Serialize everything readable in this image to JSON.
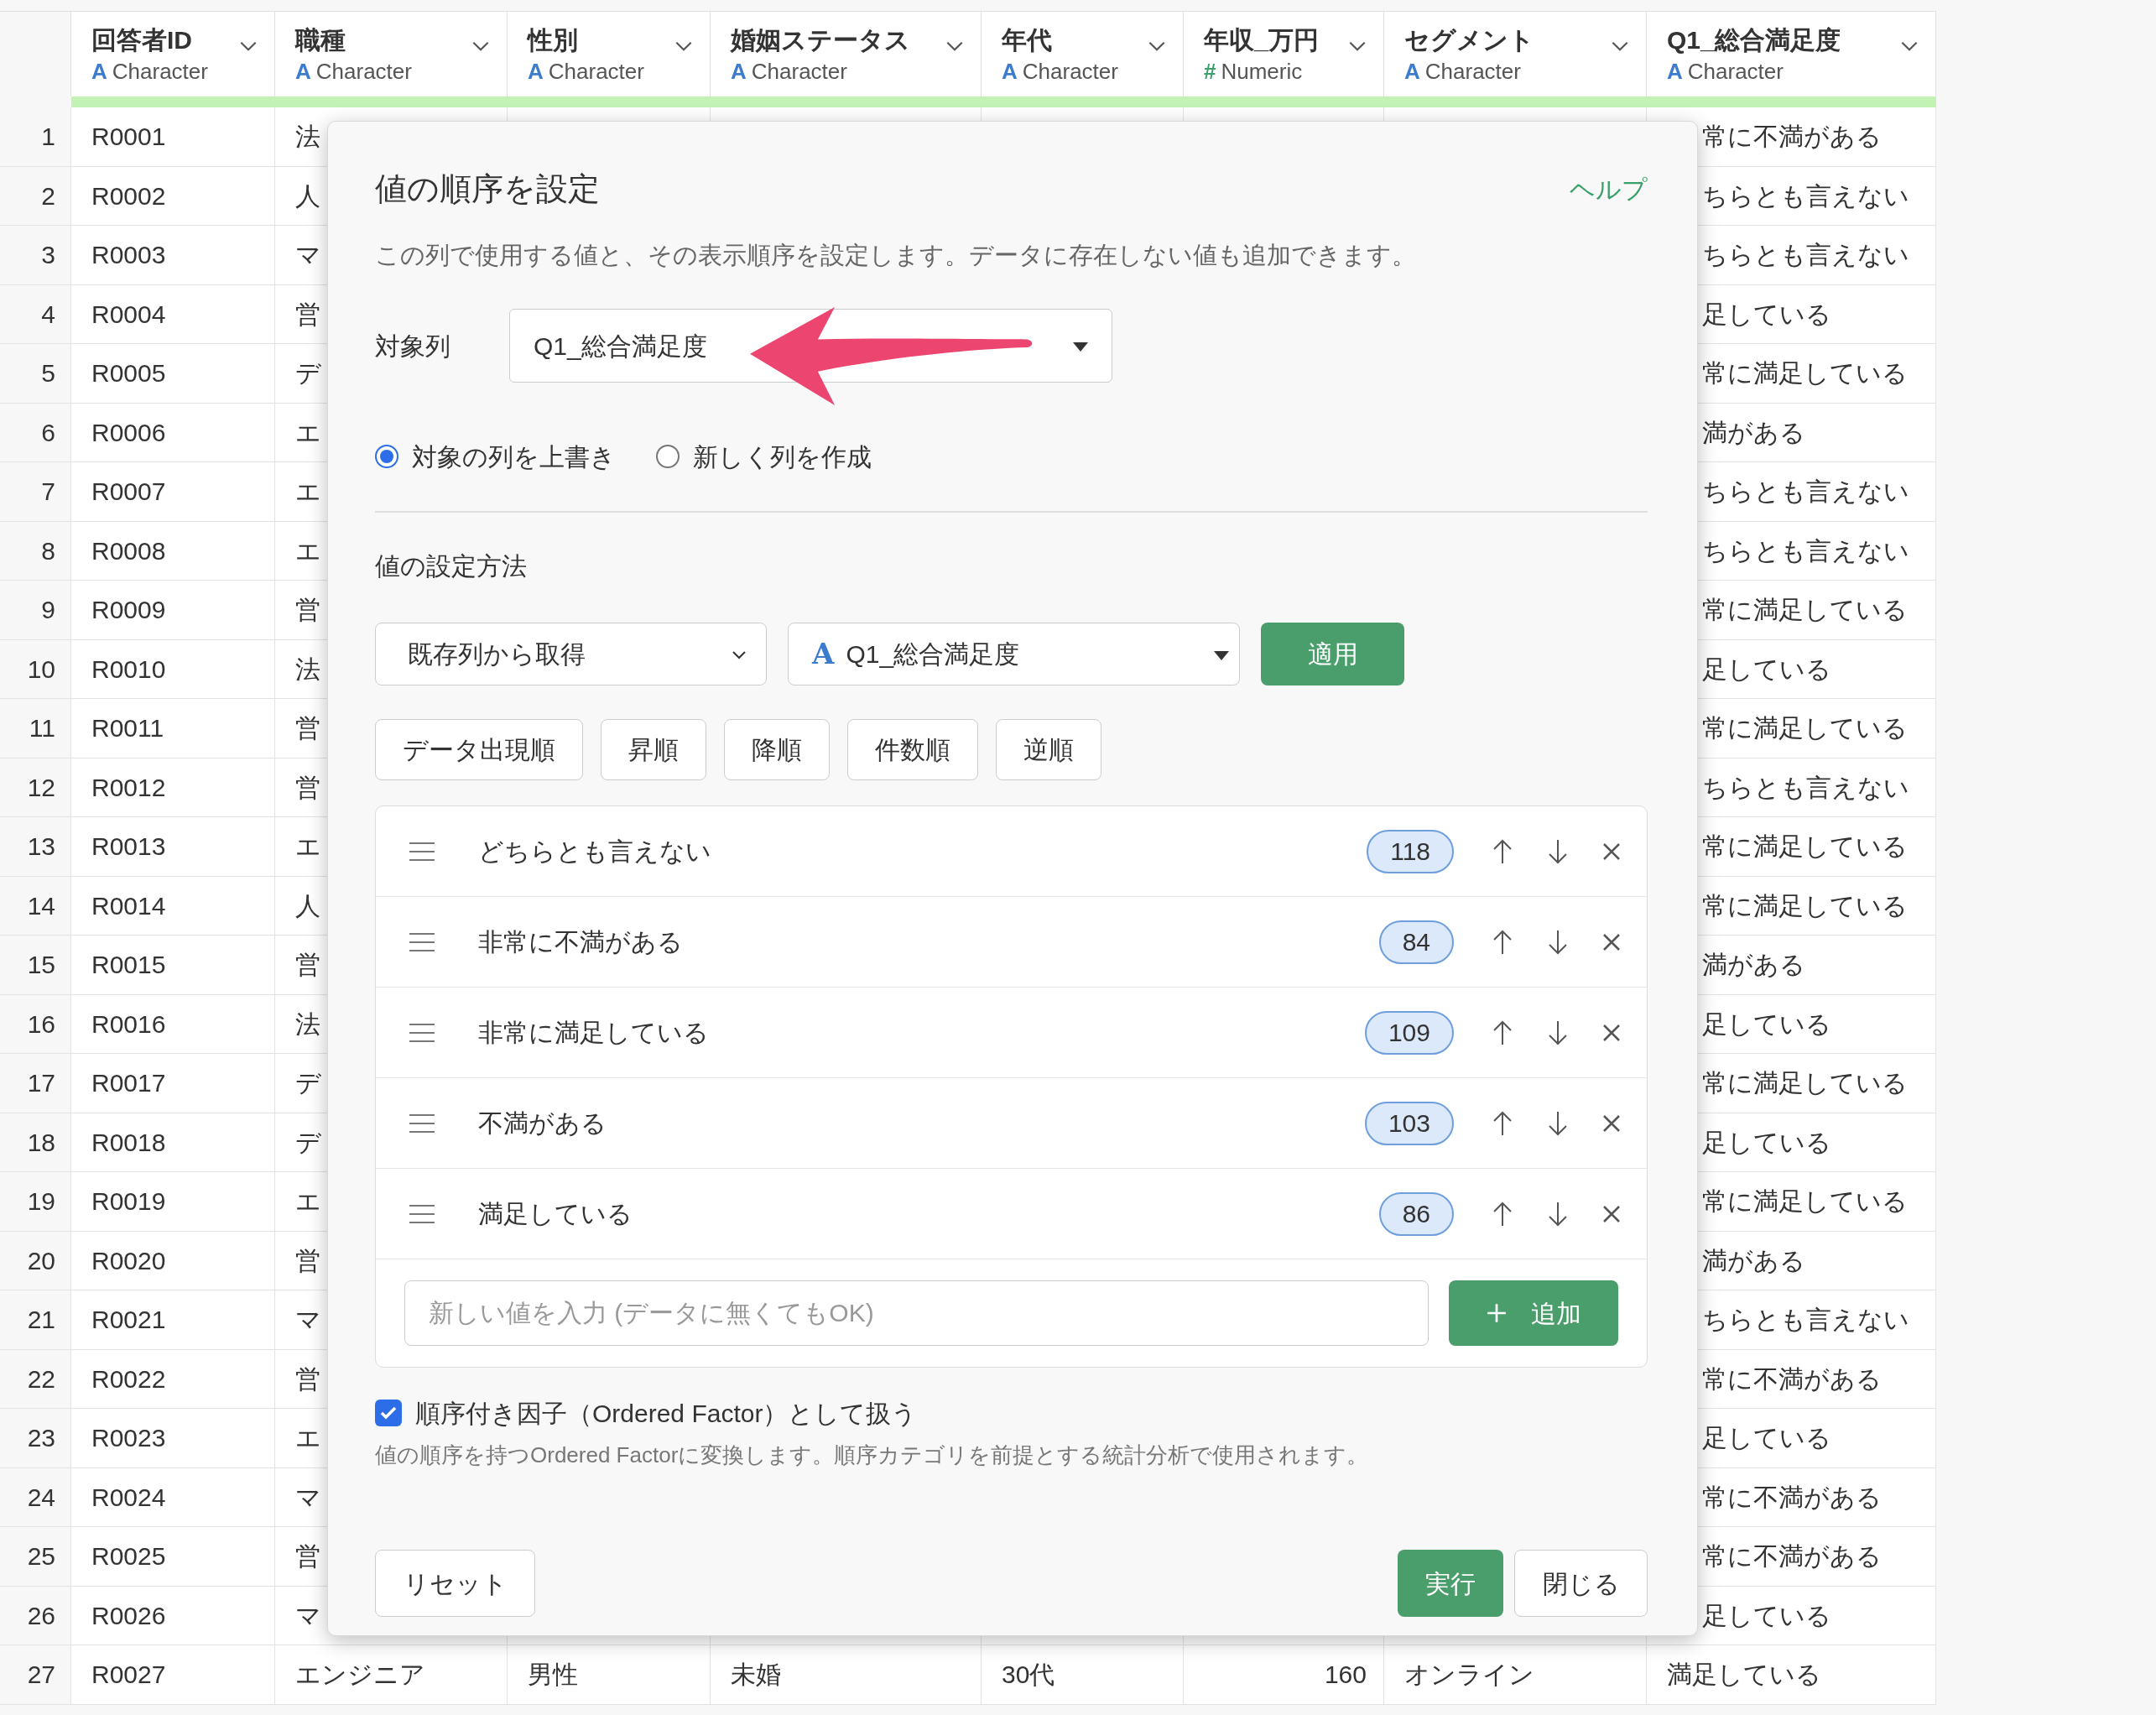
{
  "table": {
    "columns": [
      {
        "name": "回答者ID",
        "kind": "character",
        "icon": "A",
        "type": "Character"
      },
      {
        "name": "職種",
        "kind": "character",
        "icon": "A",
        "type": "Character"
      },
      {
        "name": "性別",
        "kind": "character",
        "icon": "A",
        "type": "Character"
      },
      {
        "name": "婚姻ステータス",
        "kind": "character",
        "icon": "A",
        "type": "Character"
      },
      {
        "name": "年代",
        "kind": "character",
        "icon": "A",
        "type": "Character"
      },
      {
        "name": "年収_万円",
        "kind": "numeric",
        "icon": "#",
        "type": "Numeric"
      },
      {
        "name": "セグメント",
        "kind": "character",
        "icon": "A",
        "type": "Character"
      },
      {
        "name": "Q1_総合満足度",
        "kind": "character",
        "icon": "A",
        "type": "Character"
      }
    ],
    "rows": [
      {
        "number": "1",
        "kind": "covered",
        "cells": [
          "R0001",
          "法",
          "常に不満がある"
        ]
      },
      {
        "number": "2",
        "kind": "covered",
        "cells": [
          "R0002",
          "人",
          "ちらとも言えない"
        ]
      },
      {
        "number": "3",
        "kind": "covered",
        "cells": [
          "R0003",
          "マ",
          "ちらとも言えない"
        ]
      },
      {
        "number": "4",
        "kind": "covered",
        "cells": [
          "R0004",
          "営",
          "足している"
        ]
      },
      {
        "number": "5",
        "kind": "covered",
        "cells": [
          "R0005",
          "デ",
          "常に満足している"
        ]
      },
      {
        "number": "6",
        "kind": "covered",
        "cells": [
          "R0006",
          "エ",
          "満がある"
        ]
      },
      {
        "number": "7",
        "kind": "covered",
        "cells": [
          "R0007",
          "エ",
          "ちらとも言えない"
        ]
      },
      {
        "number": "8",
        "kind": "covered",
        "cells": [
          "R0008",
          "エ",
          "ちらとも言えない"
        ]
      },
      {
        "number": "9",
        "kind": "covered",
        "cells": [
          "R0009",
          "営",
          "常に満足している"
        ]
      },
      {
        "number": "10",
        "kind": "covered",
        "cells": [
          "R0010",
          "法",
          "足している"
        ]
      },
      {
        "number": "11",
        "kind": "covered",
        "cells": [
          "R0011",
          "営",
          "常に満足している"
        ]
      },
      {
        "number": "12",
        "kind": "covered",
        "cells": [
          "R0012",
          "営",
          "ちらとも言えない"
        ]
      },
      {
        "number": "13",
        "kind": "covered",
        "cells": [
          "R0013",
          "エ",
          "常に満足している"
        ]
      },
      {
        "number": "14",
        "kind": "covered",
        "cells": [
          "R0014",
          "人",
          "常に満足している"
        ]
      },
      {
        "number": "15",
        "kind": "covered",
        "cells": [
          "R0015",
          "営",
          "満がある"
        ]
      },
      {
        "number": "16",
        "kind": "covered",
        "cells": [
          "R0016",
          "法",
          "足している"
        ]
      },
      {
        "number": "17",
        "kind": "covered",
        "cells": [
          "R0017",
          "デ",
          "常に満足している"
        ]
      },
      {
        "number": "18",
        "kind": "covered",
        "cells": [
          "R0018",
          "デ",
          "足している"
        ]
      },
      {
        "number": "19",
        "kind": "covered",
        "cells": [
          "R0019",
          "エ",
          "常に満足している"
        ]
      },
      {
        "number": "20",
        "kind": "covered",
        "cells": [
          "R0020",
          "営",
          "満がある"
        ]
      },
      {
        "number": "21",
        "kind": "covered",
        "cells": [
          "R0021",
          "マ",
          "ちらとも言えない"
        ]
      },
      {
        "number": "22",
        "kind": "covered",
        "cells": [
          "R0022",
          "営",
          "常に不満がある"
        ]
      },
      {
        "number": "23",
        "kind": "covered",
        "cells": [
          "R0023",
          "エ",
          "足している"
        ]
      },
      {
        "number": "24",
        "kind": "covered",
        "cells": [
          "R0024",
          "マ",
          "常に不満がある"
        ]
      },
      {
        "number": "25",
        "kind": "covered",
        "cells": [
          "R0025",
          "営",
          "常に不満がある"
        ]
      },
      {
        "number": "26",
        "kind": "covered",
        "cells": [
          "R0026",
          "マ",
          "足している"
        ]
      },
      {
        "number": "27",
        "kind": "full",
        "cells": [
          "R0027",
          "エンジニア",
          "男性",
          "未婚",
          "30代",
          "160",
          "オンライン",
          "満足している"
        ]
      }
    ]
  },
  "dialog": {
    "title": "値の順序を設定",
    "help_link": "ヘルプ",
    "description": "この列で使用する値と、その表示順序を設定します。データに存在しない値も追加できます。",
    "target_label": "対象列",
    "target_value": "Q1_総合満足度",
    "output_options": [
      {
        "label": "対象の列を上書き",
        "selected": true
      },
      {
        "label": "新しく列を作成",
        "selected": false
      }
    ],
    "method_heading": "値の設定方法",
    "method_value": "既存列から取得",
    "source_column": {
      "icon": "A",
      "value": "Q1_総合満足度"
    },
    "apply_button": "適用",
    "sort_buttons": [
      "データ出現順",
      "昇順",
      "降順",
      "件数順",
      "逆順"
    ],
    "values": [
      {
        "label": "どちらとも言えない",
        "count": "118"
      },
      {
        "label": "非常に不満がある",
        "count": "84"
      },
      {
        "label": "非常に満足している",
        "count": "109"
      },
      {
        "label": "不満がある",
        "count": "103"
      },
      {
        "label": "満足している",
        "count": "86"
      }
    ],
    "new_value": {
      "placeholder": "新しい値を入力 (データに無くてもOK)"
    },
    "add_button": "追加",
    "ordered_factor": {
      "label": "順序付き因子（Ordered Factor）として扱う",
      "checked": true
    },
    "ordered_factor_note": "値の順序を持つOrdered Factorに変換します。順序カテゴリを前提とする統計分析で使用されます。",
    "reset_button": "リセット",
    "run_button": "実行",
    "close_button": "閉じる"
  }
}
